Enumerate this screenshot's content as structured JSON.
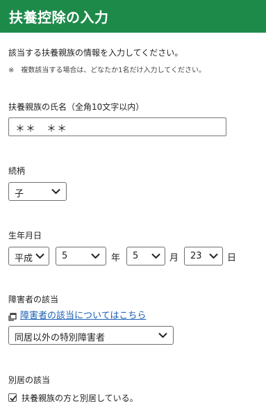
{
  "header": {
    "title": "扶養控除の入力"
  },
  "intro": {
    "text": "該当する扶養親族の情報を入力してください。",
    "note": "※　複数該当する場合は、どなたか1名だけ入力してください。"
  },
  "name_field": {
    "label": "扶養親族の氏名（全角10文字以内）",
    "value": "＊＊　＊＊"
  },
  "relationship": {
    "label": "続柄",
    "selected": "子"
  },
  "birthdate": {
    "label": "生年月日",
    "era": "平成",
    "year": "5",
    "year_unit": "年",
    "month": "5",
    "month_unit": "月",
    "day": "23",
    "day_unit": "日"
  },
  "disability": {
    "label": "障害者の該当",
    "link_text": "障害者の該当についてはこちら",
    "link_icon": "external-window-icon",
    "selected": "同居以外の特別障害者"
  },
  "separate_residence": {
    "label": "別居の該当",
    "checkbox_checked": true,
    "checkbox_label": "扶養親族の方と別居している。"
  },
  "colors": {
    "header_bg": "#1e8a4a",
    "link": "#1a5fb4"
  }
}
